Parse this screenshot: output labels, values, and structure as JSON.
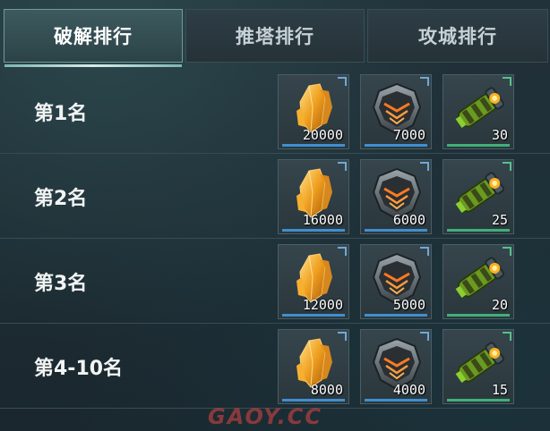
{
  "tabs": [
    {
      "label": "破解排行",
      "active": true
    },
    {
      "label": "推塔排行",
      "active": false
    },
    {
      "label": "攻城排行",
      "active": false
    }
  ],
  "rows": [
    {
      "label": "第1名",
      "items": [
        {
          "icon": "amber-crystal-icon",
          "qty": "20000"
        },
        {
          "icon": "dark-helmet-icon",
          "qty": "7000"
        },
        {
          "icon": "green-cannon-icon",
          "qty": "30"
        }
      ]
    },
    {
      "label": "第2名",
      "items": [
        {
          "icon": "amber-crystal-icon",
          "qty": "16000"
        },
        {
          "icon": "dark-helmet-icon",
          "qty": "6000"
        },
        {
          "icon": "green-cannon-icon",
          "qty": "25"
        }
      ]
    },
    {
      "label": "第3名",
      "items": [
        {
          "icon": "amber-crystal-icon",
          "qty": "12000"
        },
        {
          "icon": "dark-helmet-icon",
          "qty": "5000"
        },
        {
          "icon": "green-cannon-icon",
          "qty": "20"
        }
      ]
    },
    {
      "label": "第4-10名",
      "items": [
        {
          "icon": "amber-crystal-icon",
          "qty": "8000"
        },
        {
          "icon": "dark-helmet-icon",
          "qty": "4000"
        },
        {
          "icon": "green-cannon-icon",
          "qty": "15"
        }
      ]
    }
  ],
  "watermark": "GAOY.CC",
  "colors": {
    "accent_tab": "#6f9a9a",
    "rarity_blue": "#3f8fd0",
    "rarity_green": "#3fb07a",
    "crystal": "#f0a020",
    "helmet_glow": "#ff7a20",
    "cannon_green": "#8ccf30"
  }
}
